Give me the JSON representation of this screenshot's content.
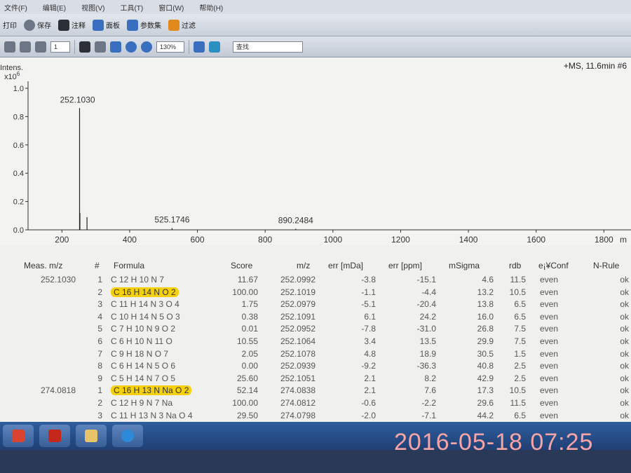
{
  "menu": {
    "items": [
      "文件(F)",
      "编辑(E)",
      "视图(V)",
      "工具(T)",
      "窗口(W)",
      "帮助(H)"
    ]
  },
  "toolbar": {
    "t1": [
      "打印",
      "保存",
      "注释",
      "面板",
      "参数集",
      "过滤"
    ],
    "page_value": "1",
    "zoom_value": "130%",
    "search_value": "查找"
  },
  "spectrum": {
    "header": "+MS, 11.6min #6",
    "y_title": "Intens.",
    "y_exp": "x10",
    "y_exp_sup": "6",
    "x_unit": "m",
    "peak_labels": [
      "252.1030",
      "525.1746",
      "890.2484"
    ]
  },
  "chart_data": {
    "type": "bar",
    "title": "",
    "xlabel": "m",
    "ylabel": "Intens. x10^6",
    "xlim": [
      100,
      1880
    ],
    "ylim": [
      0,
      1.0
    ],
    "x_ticks": [
      200,
      400,
      600,
      800,
      1000,
      1200,
      1400,
      1600,
      1800
    ],
    "y_ticks": [
      "0.0",
      "0.2",
      "0.4",
      "0.6",
      "0.8",
      "1.0"
    ],
    "peaks": [
      {
        "mz": 252.103,
        "intensity": 0.86,
        "label": "252.1030"
      },
      {
        "mz": 253.1,
        "intensity": 0.12
      },
      {
        "mz": 274.08,
        "intensity": 0.09
      },
      {
        "mz": 525.1746,
        "intensity": 0.012,
        "label": "525.1746"
      },
      {
        "mz": 890.2484,
        "intensity": 0.008,
        "label": "890.2484"
      }
    ]
  },
  "table": {
    "headers": [
      "Meas. m/z",
      "#",
      "Formula",
      "Score",
      "m/z",
      "err [mDa]",
      "err [ppm]",
      "mSigma",
      "rdb",
      "e¡¥Conf",
      "N-Rule"
    ],
    "rows": [
      {
        "meas": "252.1030",
        "n": "1",
        "formula": "C 12 H 10 N 7",
        "score": "11.67",
        "mz": "252.0992",
        "mda": "-3.8",
        "ppm": "-15.1",
        "msigma": "4.6",
        "rdb": "11.5",
        "conf": "even",
        "nrule": "ok",
        "hl": false
      },
      {
        "meas": "",
        "n": "2",
        "formula": "C 16 H 14 N O 2",
        "score": "100.00",
        "mz": "252.1019",
        "mda": "-1.1",
        "ppm": "-4.4",
        "msigma": "13.2",
        "rdb": "10.5",
        "conf": "even",
        "nrule": "ok",
        "hl": true
      },
      {
        "meas": "",
        "n": "3",
        "formula": "C 11 H 14 N 3 O 4",
        "score": "1.75",
        "mz": "252.0979",
        "mda": "-5.1",
        "ppm": "-20.4",
        "msigma": "13.8",
        "rdb": "6.5",
        "conf": "even",
        "nrule": "ok",
        "hl": false
      },
      {
        "meas": "",
        "n": "4",
        "formula": "C 10 H 14 N 5 O 3",
        "score": "0.38",
        "mz": "252.1091",
        "mda": "6.1",
        "ppm": "24.2",
        "msigma": "16.0",
        "rdb": "6.5",
        "conf": "even",
        "nrule": "ok",
        "hl": false
      },
      {
        "meas": "",
        "n": "5",
        "formula": "C 7 H 10 N 9 O 2",
        "score": "0.01",
        "mz": "252.0952",
        "mda": "-7.8",
        "ppm": "-31.0",
        "msigma": "26.8",
        "rdb": "7.5",
        "conf": "even",
        "nrule": "ok",
        "hl": false
      },
      {
        "meas": "",
        "n": "6",
        "formula": "C 6 H 10 N 11 O",
        "score": "10.55",
        "mz": "252.1064",
        "mda": "3.4",
        "ppm": "13.5",
        "msigma": "29.9",
        "rdb": "7.5",
        "conf": "even",
        "nrule": "ok",
        "hl": false
      },
      {
        "meas": "",
        "n": "7",
        "formula": "C 9 H 18 N O 7",
        "score": "2.05",
        "mz": "252.1078",
        "mda": "4.8",
        "ppm": "18.9",
        "msigma": "30.5",
        "rdb": "1.5",
        "conf": "even",
        "nrule": "ok",
        "hl": false
      },
      {
        "meas": "",
        "n": "8",
        "formula": "C 6 H 14 N 5 O 6",
        "score": "0.00",
        "mz": "252.0939",
        "mda": "-9.2",
        "ppm": "-36.3",
        "msigma": "40.8",
        "rdb": "2.5",
        "conf": "even",
        "nrule": "ok",
        "hl": false
      },
      {
        "meas": "",
        "n": "9",
        "formula": "C 5 H 14 N 7 O 5",
        "score": "25.60",
        "mz": "252.1051",
        "mda": "2.1",
        "ppm": "8.2",
        "msigma": "42.9",
        "rdb": "2.5",
        "conf": "even",
        "nrule": "ok",
        "hl": false
      },
      {
        "meas": "274.0818",
        "n": "1",
        "formula": "C 16 H 13 N Na O 2",
        "score": "52.14",
        "mz": "274.0838",
        "mda": "2.1",
        "ppm": "7.6",
        "msigma": "17.3",
        "rdb": "10.5",
        "conf": "even",
        "nrule": "ok",
        "hl": true
      },
      {
        "meas": "",
        "n": "2",
        "formula": "C 12 H 9 N 7 Na",
        "score": "100.00",
        "mz": "274.0812",
        "mda": "-0.6",
        "ppm": "-2.2",
        "msigma": "29.6",
        "rdb": "11.5",
        "conf": "even",
        "nrule": "ok",
        "hl": false
      },
      {
        "meas": "",
        "n": "3",
        "formula": "C 11 H 13 N 3 Na O 4",
        "score": "29.50",
        "mz": "274.0798",
        "mda": "-2.0",
        "ppm": "-7.1",
        "msigma": "44.2",
        "rdb": "6.5",
        "conf": "even",
        "nrule": "ok",
        "hl": false
      }
    ]
  },
  "taskbar": {
    "items": [
      "office-icon",
      "pdf-icon",
      "folder-icon",
      "browser-icon"
    ]
  },
  "overlay": {
    "timestamp": "2016-05-18 07:25"
  },
  "colors": {
    "highlight": "#f4d00e",
    "timestamp": "#f6a4a6",
    "taskbar": "#2f5e9e"
  }
}
